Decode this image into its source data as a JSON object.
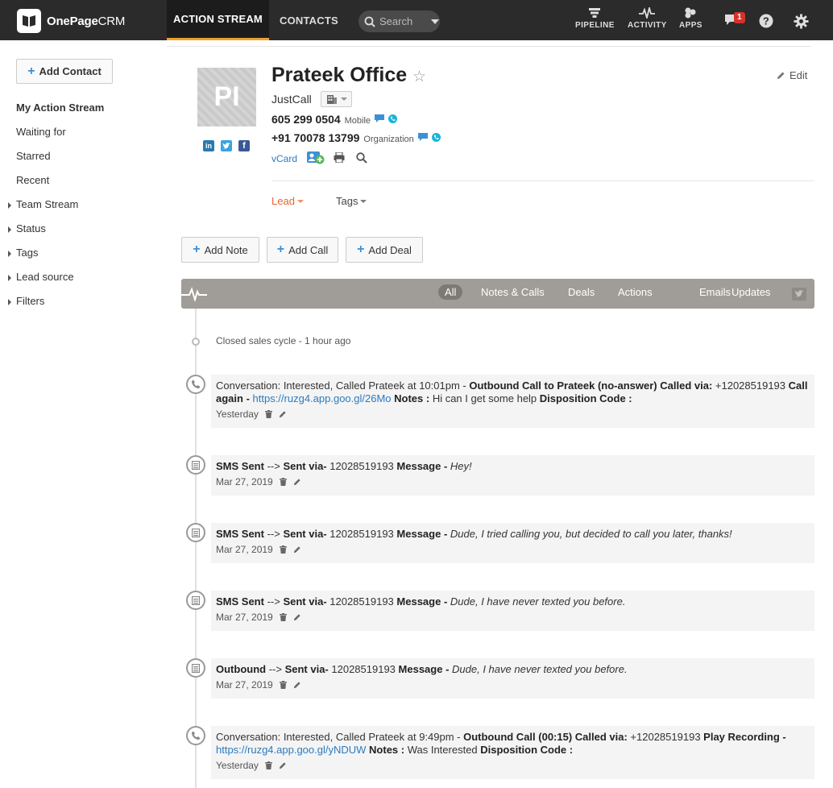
{
  "app": {
    "brand_main": "OnePage",
    "brand_sub": "CRM"
  },
  "nav": {
    "action_stream": "ACTION STREAM",
    "contacts": "CONTACTS",
    "search_placeholder": "Search",
    "pipeline": "PIPELINE",
    "activity": "ACTIVITY",
    "apps": "APPS",
    "notification_count": "1"
  },
  "sidebar": {
    "add_contact": "Add Contact",
    "items": [
      {
        "label": "My Action Stream"
      },
      {
        "label": "Waiting for"
      },
      {
        "label": "Starred"
      },
      {
        "label": "Recent"
      },
      {
        "label": "Team Stream"
      },
      {
        "label": "Status"
      },
      {
        "label": "Tags"
      },
      {
        "label": "Lead source"
      },
      {
        "label": "Filters"
      }
    ]
  },
  "contact": {
    "initials": "PI",
    "name": "Prateek Office",
    "edit": "Edit",
    "company": "JustCall",
    "phones": [
      {
        "number": "605 299 0504",
        "type": "Mobile"
      },
      {
        "number": "+91 70078 13799",
        "type": "Organization"
      }
    ],
    "vcard": "vCard",
    "status": "Lead",
    "tags": "Tags"
  },
  "actions": {
    "add_note": "Add Note",
    "add_call": "Add Call",
    "add_deal": "Add Deal"
  },
  "filters": {
    "all": "All",
    "notes_calls": "Notes & Calls",
    "deals": "Deals",
    "actions": "Actions",
    "emails": "Emails",
    "updates": "Updates"
  },
  "timeline": {
    "closed": "Closed sales cycle - 1 hour ago",
    "entries": [
      {
        "p1": "Conversation: Interested, Called Prateek at 10:01pm - ",
        "b1": "Outbound Call to Prateek (no-answer) Called via:",
        "p2": " +12028519193 ",
        "b2": "Call again - ",
        "link": "https://ruzg4.app.goo.gl/26Mo",
        "b3": " Notes :",
        "p3": " Hi can I get some help ",
        "b4": "Disposition Code :",
        "date": "Yesterday"
      },
      {
        "b1": "SMS Sent",
        "p1": " --> ",
        "b2": "Sent via-",
        "p2": " 12028519193 ",
        "b3": "Message -",
        "msg": "Hey!",
        "date": "Mar 27, 2019"
      },
      {
        "b1": "SMS Sent",
        "p1": " --> ",
        "b2": "Sent via-",
        "p2": " 12028519193 ",
        "b3": "Message -",
        "msg": "Dude, I tried calling you, but decided to call you later, thanks!",
        "date": "Mar 27, 2019"
      },
      {
        "b1": "SMS Sent",
        "p1": " --> ",
        "b2": "Sent via-",
        "p2": " 12028519193 ",
        "b3": "Message -",
        "msg": "Dude, I have never texted you before.",
        "date": "Mar 27, 2019"
      },
      {
        "b1": "Outbound",
        "p1": " --> ",
        "b2": "Sent via-",
        "p2": " 12028519193 ",
        "b3": "Message -",
        "msg": "Dude, I have never texted you before.",
        "date": "Mar 27, 2019"
      },
      {
        "p1": "Conversation: Interested, Called Prateek at 9:49pm - ",
        "b1": "Outbound Call (00:15) Called via:",
        "p2": " +12028519193 ",
        "b2": "Play Recording -",
        "link": "https://ruzg4.app.goo.gl/yNDUW",
        "b3": " Notes :",
        "p3": " Was Interested ",
        "b4": "Disposition Code :",
        "date": "Yesterday"
      }
    ]
  },
  "colors": {
    "topbar": "#2b2b2b",
    "accent_orange": "#e8652e",
    "link_blue": "#2b7bc0",
    "filterbar": "#a09d98"
  }
}
